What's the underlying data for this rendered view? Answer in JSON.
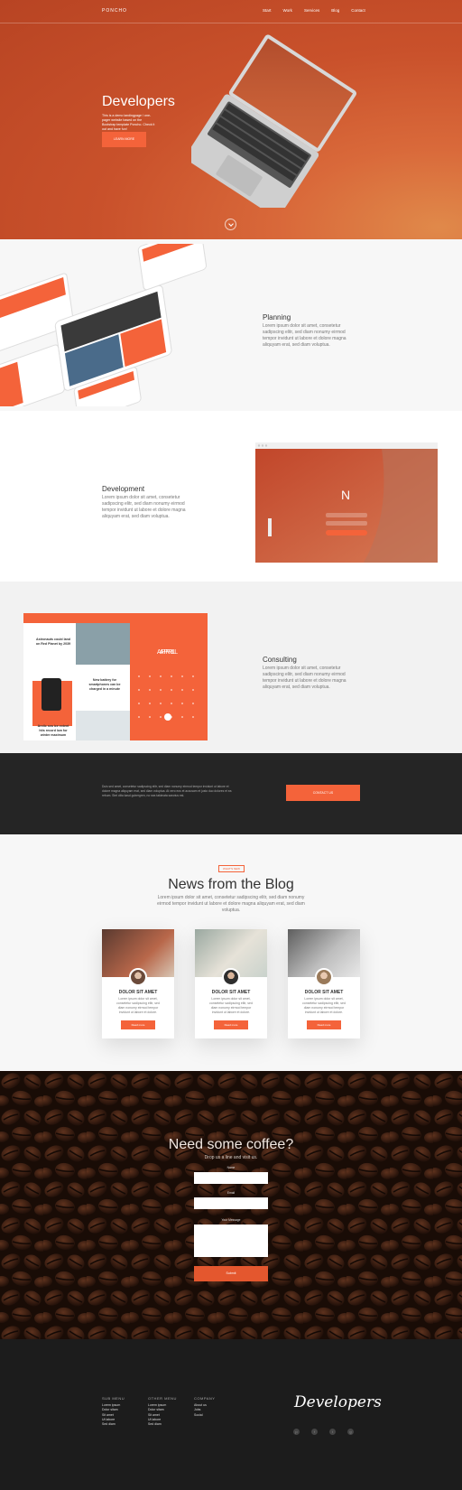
{
  "nav": {
    "brand": "PONCHO",
    "links": [
      "Start",
      "Work",
      "Services",
      "Blog",
      "Contact"
    ]
  },
  "hero": {
    "title": "Developers",
    "text": "This is a demo landingpage / one-pager website based on the Bootstrap template Poncho. Check it out and have fun!",
    "button": "LEARN MORE"
  },
  "planning": {
    "title": "Planning",
    "text": "Lorem ipsum dolor sit amet, consetetur sadipscing elitr, sed diam nonumy eirmod tempor invidunt ut labore et dolore magna aliquyam erat, sed diam voluptua."
  },
  "development": {
    "title": "Development",
    "text": "Lorem ipsum dolor sit amet, consetetur sadipscing elitr, sed diam nonumy eirmod tempor invidunt ut labore et dolore magna aliquyam erat, sed diam voluptua."
  },
  "consulting": {
    "title": "Consulting",
    "text": "Lorem ipsum dolor sit amet, consetetur sadipscing elitr, sed diam nonumy eirmod tempor invidunt ut labore et dolore magna aliquyam erat, sed diam voluptua.",
    "calendar_month": "APRIL",
    "articles": [
      "Astronauts could land on Red Planet by 2039",
      "New battery for smartphones can be charged in a minute",
      "Arctic sea ice extent hits record low for winter maximum"
    ]
  },
  "cta": {
    "text": "Duis sed amet, consetetur sadipscing elitr, sed diam nonumy eirmod tempor invidunt ut labore et dolore magna aliquyam erat, sed diam voluptua. At vero eos et accusam et justo duo dolores et ea rebum. Stet clita kasd gubergren, no sea takimata sanctus est.",
    "button": "CONTACT US"
  },
  "blog": {
    "badge": "WHAT'S NEW",
    "title": "News from the Blog",
    "subtitle": "Lorem ipsum dolor sit amet, consetetur sadipscing elitr, sed diam nonumy eirmod tempor invidunt ut labore et dolore magna aliquyam erat, sed diam voluptua.",
    "cards": [
      {
        "title": "DOLOR SIT AMET",
        "text": "Lorem ipsum dolor sit amet, consetetur sadipscing elitr, sed diam nonumy eirmod tempor invidunt ut labore et dolore.",
        "button": "Read more"
      },
      {
        "title": "DOLOR SIT AMET",
        "text": "Lorem ipsum dolor sit amet, consetetur sadipscing elitr, sed diam nonumy eirmod tempor invidunt ut labore et dolore.",
        "button": "Read more"
      },
      {
        "title": "DOLOR SIT AMET",
        "text": "Lorem ipsum dolor sit amet, consetetur sadipscing elitr, sed diam nonumy eirmod tempor invidunt ut labore et dolore.",
        "button": "Read more"
      }
    ]
  },
  "contact": {
    "title": "Need some coffee?",
    "subtitle": "Drop us a line and visit us.",
    "name_label": "Name",
    "email_label": "Email",
    "message_label": "Your Message",
    "submit": "Submit"
  },
  "footer": {
    "col1": {
      "head": "SUB MENU",
      "items": [
        "Lorem ipsum",
        "Dolor sitam",
        "Sit amet",
        "Ut labore",
        "Sed diam"
      ]
    },
    "col2": {
      "head": "OTHER MENU",
      "items": [
        "Lorem ipsum",
        "Dolor sitam",
        "Sit amet",
        "Ut labore",
        "Sed diam"
      ]
    },
    "col3": {
      "head": "COMPANY",
      "items": [
        "About us",
        "Jobs",
        "Social"
      ]
    },
    "logo": "Developers",
    "social_icons": [
      "pinterest-icon",
      "facebook-icon",
      "twitter-icon",
      "github-icon"
    ]
  },
  "colors": {
    "accent": "#f4633a",
    "dark": "#252525",
    "footer": "#1c1c1c"
  }
}
